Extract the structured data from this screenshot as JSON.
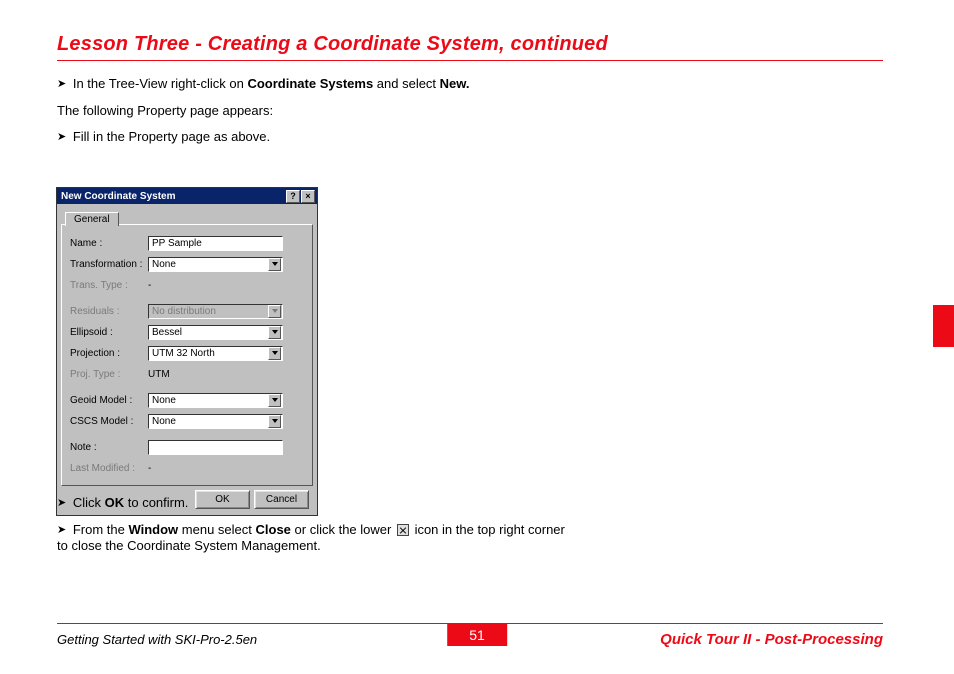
{
  "heading": "Lesson Three - Creating a Coordinate System, continued",
  "body": {
    "step1_pre": "In the Tree-View right-click on ",
    "step1_bold1": "Coordinate Systems",
    "step1_mid": " and select ",
    "step1_bold2": "New.",
    "prop_appears": "The following Property page appears:",
    "step2": "Fill in the Property page as above.",
    "step3_pre": "Click ",
    "step3_bold": "OK",
    "step3_post": " to confirm.",
    "step4_pre": "From the ",
    "step4_bold1": "Window",
    "step4_mid1": " menu select ",
    "step4_bold2": "Close",
    "step4_mid2": " or click the lower ",
    "step4_post": " icon in the top right corner to close the Coordinate System Management."
  },
  "dialog": {
    "title": "New Coordinate System",
    "help_btn": "?",
    "close_btn": "×",
    "tab": "General",
    "labels": {
      "name": "Name :",
      "transformation": "Transformation :",
      "trans_type": "Trans. Type :",
      "residuals": "Residuals :",
      "ellipsoid": "Ellipsoid :",
      "projection": "Projection :",
      "proj_type": "Proj. Type :",
      "geoid_model": "Geoid Model :",
      "cscs_model": "CSCS Model :",
      "note": "Note :",
      "last_modified": "Last Modified :"
    },
    "values": {
      "name": "PP Sample",
      "transformation": "None",
      "trans_type": "-",
      "residuals": "No distribution",
      "ellipsoid": "Bessel",
      "projection": "UTM 32 North",
      "proj_type": "UTM",
      "geoid_model": "None",
      "cscs_model": "None",
      "note": "",
      "last_modified": "-"
    },
    "buttons": {
      "ok": "OK",
      "cancel": "Cancel"
    }
  },
  "footer": {
    "left": "Getting Started with SKI-Pro-2.5en",
    "page": "51",
    "right": "Quick Tour II - Post-Processing"
  }
}
